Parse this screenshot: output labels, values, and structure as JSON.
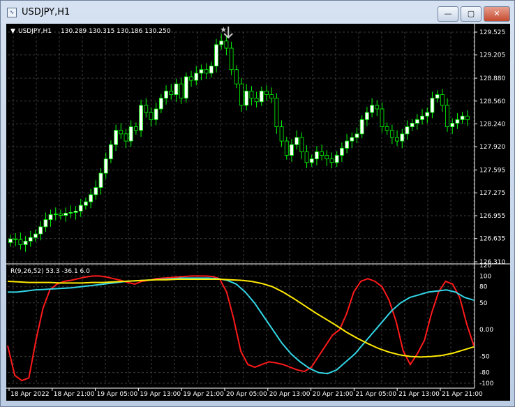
{
  "window": {
    "title": "USDJPY,H1",
    "minimize_label": "—",
    "maximize_label": "▢",
    "close_label": "✕"
  },
  "colors": {
    "background": "#000000",
    "bull_candle": "#ffffff",
    "bear_candle": "#000000",
    "candle_wick": "#00ff00",
    "grid": "#3c3c3c",
    "axis_text": "#ffffff",
    "line_red": "#ff1a1a",
    "line_cyan": "#33d6e6",
    "line_yellow": "#ffea00",
    "arrow": "#c8c8c8"
  },
  "chart_data": [
    {
      "type": "candlestick",
      "symbol_header": "USDJPY,H1",
      "ohlc_header": "130.289 130.315 130.186 130.250",
      "y_ticks": [
        "129.525",
        "129.205",
        "128.880",
        "128.560",
        "128.240",
        "127.920",
        "127.595",
        "127.275",
        "126.955",
        "126.635",
        "126.310"
      ],
      "ylim": [
        126.31,
        129.525
      ],
      "closes": [
        126.63,
        126.62,
        126.55,
        126.6,
        126.65,
        126.7,
        126.8,
        126.9,
        126.97,
        126.98,
        126.96,
        126.99,
        127.0,
        127.02,
        127.1,
        127.15,
        127.25,
        127.35,
        127.55,
        127.75,
        127.95,
        128.15,
        128.1,
        128.0,
        128.2,
        128.15,
        128.5,
        128.4,
        128.3,
        128.45,
        128.6,
        128.7,
        128.65,
        128.8,
        128.6,
        128.9,
        128.85,
        128.95,
        129.0,
        128.95,
        129.05,
        129.35,
        129.4,
        129.3,
        129.0,
        128.8,
        128.5,
        128.7,
        128.6,
        128.55,
        128.7,
        128.65,
        128.6,
        128.2,
        128.0,
        127.8,
        127.95,
        128.05,
        127.85,
        127.7,
        127.75,
        127.85,
        127.8,
        127.75,
        127.7,
        127.8,
        127.9,
        128.0,
        128.05,
        128.1,
        128.3,
        128.4,
        128.5,
        128.45,
        128.2,
        128.15,
        128.05,
        128.0,
        128.1,
        128.2,
        128.25,
        128.3,
        128.35,
        128.4,
        128.6,
        128.65,
        128.5,
        128.2,
        128.25,
        128.3,
        128.35,
        128.3
      ]
    },
    {
      "type": "line",
      "header": "R(9,26,52) 53.3 -36.1 6.0",
      "y_ticks": [
        "120",
        "100",
        "80",
        "50",
        "0.00",
        "-50",
        "-80",
        "-100"
      ],
      "ylim": [
        -100,
        120
      ],
      "x_ticks": [
        "18 Apr 2022",
        "18 Apr 21:00",
        "19 Apr 05:00",
        "19 Apr 13:00",
        "19 Apr 21:00",
        "20 Apr 05:00",
        "20 Apr 13:00",
        "20 Apr 21:00",
        "21 Apr 05:00",
        "21 Apr 13:00",
        "21 Apr 21:00"
      ],
      "series": [
        {
          "color": "#ff1a1a",
          "values": [
            -30,
            -85,
            -95,
            -90,
            -20,
            40,
            75,
            85,
            90,
            92,
            95,
            98,
            100,
            100,
            98,
            95,
            92,
            88,
            85,
            90,
            92,
            95,
            96,
            97,
            98,
            99,
            100,
            100,
            100,
            99,
            95,
            70,
            20,
            -40,
            -65,
            -70,
            -65,
            -60,
            -62,
            -65,
            -70,
            -75,
            -78,
            -70,
            -50,
            -30,
            -10,
            0,
            30,
            70,
            90,
            95,
            90,
            80,
            55,
            15,
            -40,
            -65,
            -45,
            -20,
            30,
            70,
            90,
            85,
            60,
            10,
            -30
          ]
        },
        {
          "color": "#33d6e6",
          "values": [
            70,
            70,
            72,
            74,
            75,
            76,
            77,
            78,
            80,
            82,
            84,
            86,
            88,
            90,
            91,
            92,
            93,
            94,
            95,
            96,
            96,
            96,
            96,
            95,
            92,
            85,
            70,
            50,
            25,
            0,
            -25,
            -45,
            -60,
            -72,
            -80,
            -82,
            -75,
            -60,
            -45,
            -25,
            -5,
            15,
            35,
            50,
            60,
            65,
            70,
            72,
            74,
            70,
            60,
            55
          ]
        },
        {
          "color": "#ffea00",
          "values": [
            90,
            89,
            88,
            88,
            88,
            87,
            87,
            87,
            88,
            88,
            89,
            90,
            91,
            92,
            93,
            93,
            94,
            94,
            94,
            94,
            94,
            93,
            92,
            90,
            86,
            80,
            70,
            58,
            45,
            32,
            20,
            8,
            -5,
            -16,
            -26,
            -35,
            -42,
            -47,
            -50,
            -51,
            -50,
            -48,
            -44,
            -38,
            -32
          ]
        }
      ]
    }
  ]
}
